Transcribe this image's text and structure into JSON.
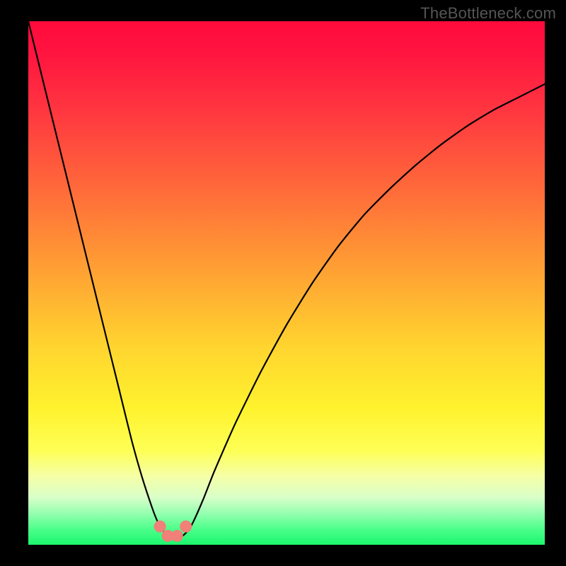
{
  "watermark": "TheBottleneck.com",
  "chart_data": {
    "type": "line",
    "title": "",
    "xlabel": "",
    "ylabel": "",
    "xlim": [
      0,
      100
    ],
    "ylim": [
      0,
      100
    ],
    "series": [
      {
        "name": "bottleneck-curve",
        "x": [
          0,
          2,
          4,
          6,
          8,
          10,
          12,
          14,
          16,
          18,
          20,
          22,
          24,
          25,
          26,
          27,
          28,
          29,
          30,
          31,
          32,
          34,
          36,
          40,
          45,
          50,
          55,
          60,
          65,
          70,
          75,
          80,
          85,
          90,
          95,
          100
        ],
        "y": [
          100,
          92,
          84,
          76,
          68,
          60,
          52,
          44,
          36,
          28,
          20,
          13,
          7,
          4.5,
          2.8,
          1.8,
          1.3,
          1.3,
          1.8,
          2.8,
          4.5,
          9,
          14,
          23,
          33,
          42,
          50,
          57,
          63,
          68,
          72.5,
          76.5,
          80,
          83,
          85.5,
          88
        ]
      }
    ],
    "markers": [
      {
        "x": 25.5,
        "y": 3.5
      },
      {
        "x": 27.0,
        "y": 1.7
      },
      {
        "x": 28.8,
        "y": 1.7
      },
      {
        "x": 30.5,
        "y": 3.5
      }
    ],
    "marker_color": "#f08078",
    "background_gradient": {
      "orientation": "vertical",
      "stops": [
        {
          "pos": 0.0,
          "color": "#ff0a3c"
        },
        {
          "pos": 0.5,
          "color": "#ffb030"
        },
        {
          "pos": 0.8,
          "color": "#fff22e"
        },
        {
          "pos": 1.0,
          "color": "#1cf56e"
        }
      ]
    }
  }
}
